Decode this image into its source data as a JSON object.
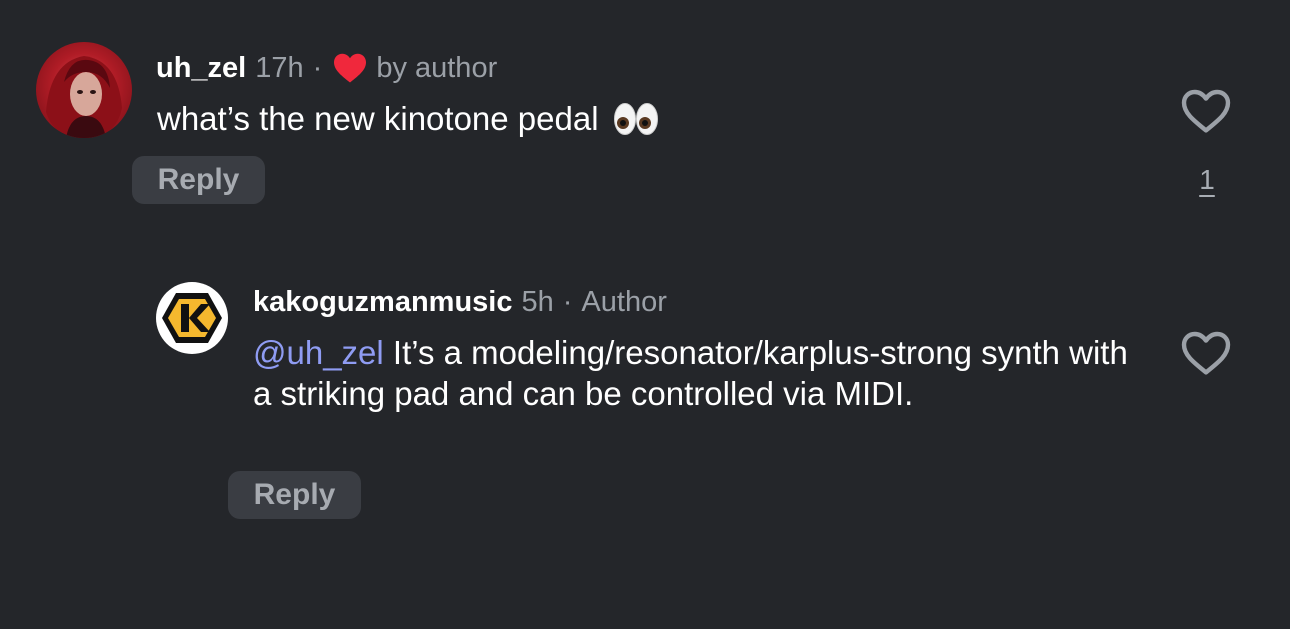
{
  "comments": [
    {
      "username": "uh_zel",
      "time": "17h",
      "separator": "·",
      "badge": "by author",
      "text": "what’s the new kinotone pedal",
      "emoji": "eyes-emoji",
      "reply_label": "Reply",
      "like_count": "1"
    },
    {
      "username": "kakoguzmanmusic",
      "time": "5h",
      "separator": "·",
      "badge": "Author",
      "mention": "@uh_zel",
      "text": " It’s a modeling/resonator/karplus-strong synth with a striking pad and can be controlled via MIDI.",
      "reply_label": "Reply"
    }
  ],
  "icons": {
    "liked_by_author": "heart-filled-icon",
    "like": "heart-outline-icon",
    "brand_logo": "k-hexagon-logo-icon"
  },
  "colors": {
    "background": "#24262a",
    "muted_text": "#9ba0a7",
    "mention": "#8f9cf3",
    "heart": "#f0283c",
    "logo_yellow": "#f5b82e",
    "reply_bg": "#3a3d43"
  }
}
